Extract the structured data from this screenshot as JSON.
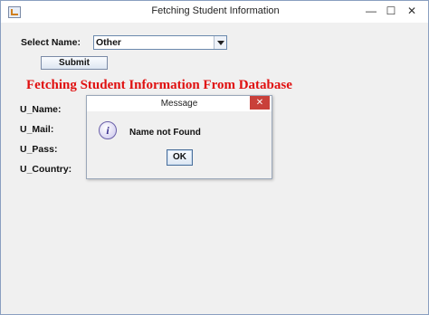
{
  "window": {
    "title": "Fetching Student Information",
    "minimize": "—",
    "maximize": "☐",
    "close": "✕"
  },
  "form": {
    "select_label": "Select Name:",
    "selected_name": "Other",
    "submit_label": "Submit",
    "heading": "Fetching Student Information From Database",
    "fields": {
      "name": "U_Name:",
      "mail": "U_Mail:",
      "pass": "U_Pass:",
      "country": "U_Country:"
    }
  },
  "dialog": {
    "title": "Message",
    "close": "✕",
    "icon": "i",
    "message": "Name not Found",
    "ok_label": "OK"
  },
  "colors": {
    "heading": "#e01010",
    "dialog_close": "#c9403a"
  },
  "icons": {
    "app": "java-app-icon",
    "info": "info-icon"
  }
}
